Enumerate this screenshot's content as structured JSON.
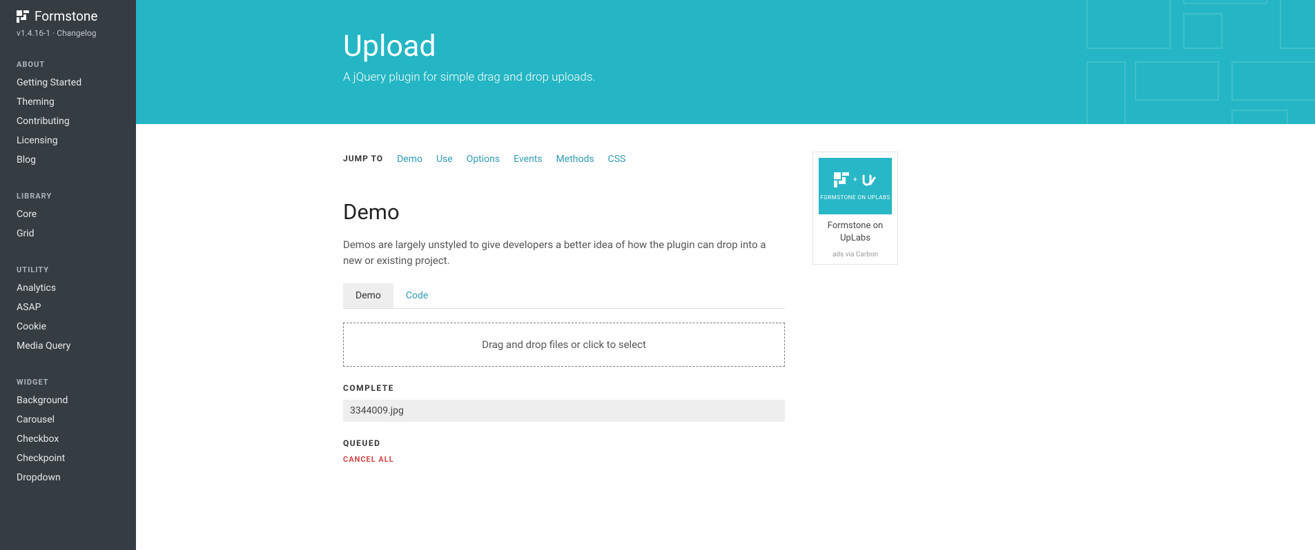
{
  "brand": {
    "name": "Formstone",
    "version": "v1.4.16-1",
    "sep": "·",
    "changelog": "Changelog"
  },
  "nav": {
    "sections": [
      {
        "heading": "ABOUT",
        "items": [
          "Getting Started",
          "Theming",
          "Contributing",
          "Licensing",
          "Blog"
        ]
      },
      {
        "heading": "LIBRARY",
        "items": [
          "Core",
          "Grid"
        ]
      },
      {
        "heading": "UTILITY",
        "items": [
          "Analytics",
          "ASAP",
          "Cookie",
          "Media Query"
        ]
      },
      {
        "heading": "WIDGET",
        "items": [
          "Background",
          "Carousel",
          "Checkbox",
          "Checkpoint",
          "Dropdown"
        ]
      }
    ]
  },
  "hero": {
    "title": "Upload",
    "subtitle": "A jQuery plugin for simple drag and drop uploads."
  },
  "jump": {
    "label": "JUMP TO",
    "links": [
      "Demo",
      "Use",
      "Options",
      "Events",
      "Methods",
      "CSS"
    ]
  },
  "demo": {
    "title": "Demo",
    "desc": "Demos are largely unstyled to give developers a better idea of how the plugin can drop into a new or existing project.",
    "tabs": {
      "demo": "Demo",
      "code": "Code"
    },
    "drop_text": "Drag and drop files or click to select",
    "complete_label": "COMPLETE",
    "complete_file": "3344009.jpg",
    "queued_label": "QUEUED",
    "cancel_all": "CANCEL ALL"
  },
  "ad": {
    "banner_label": "FORMSTONE ON UPLABS",
    "caption": "Formstone on UpLabs",
    "source": "ads via Carbon"
  }
}
